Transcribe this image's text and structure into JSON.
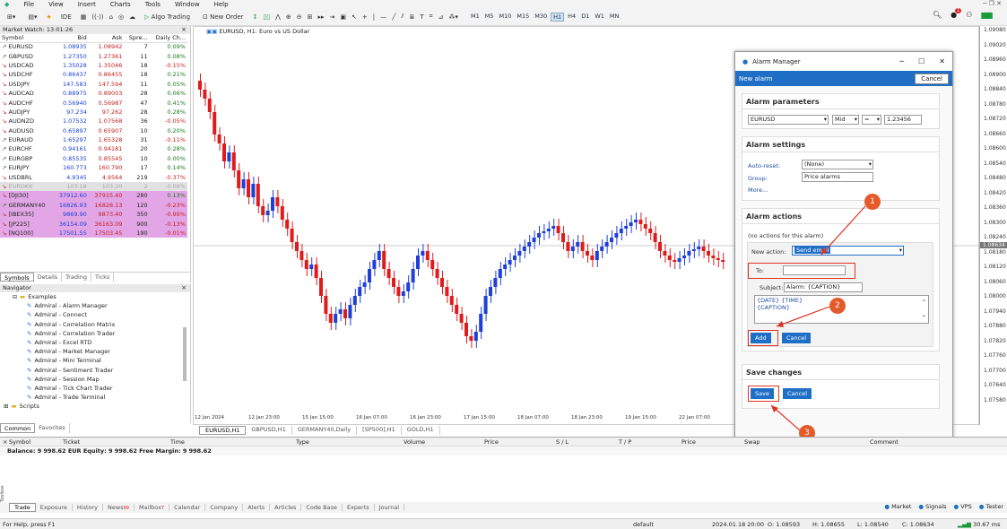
{
  "menu": [
    "File",
    "View",
    "Insert",
    "Charts",
    "Tools",
    "Window",
    "Help"
  ],
  "toolbar": {
    "ide_label": "IDE",
    "algo_label": "Algo Trading",
    "new_order_label": "New Order",
    "timeframes": [
      "M1",
      "M5",
      "M10",
      "M15",
      "M30",
      "H1",
      "H4",
      "D1",
      "W1",
      "MN"
    ],
    "active_timeframe": "H1",
    "notif_count": "1"
  },
  "market_watch": {
    "title": "Market Watch: 13:01:26",
    "headers": [
      "Symbol",
      "Bid",
      "Ask",
      "Spre...",
      "Daily Ch..."
    ],
    "rows": [
      {
        "dir": "up",
        "sym": "EURUSD",
        "bid": "1.08935",
        "ask": "1.08942",
        "spread": "7",
        "chg": "0.09%",
        "cls": ""
      },
      {
        "dir": "up",
        "sym": "GBPUSD",
        "bid": "1.27350",
        "ask": "1.27361",
        "spread": "11",
        "chg": "0.08%",
        "cls": ""
      },
      {
        "dir": "dn",
        "sym": "USDCAD",
        "bid": "1.35028",
        "ask": "1.35046",
        "spread": "18",
        "chg": "-0.15%",
        "cls": ""
      },
      {
        "dir": "dn",
        "sym": "USDCHF",
        "bid": "0.86437",
        "ask": "0.86455",
        "spread": "18",
        "chg": "0.21%",
        "cls": ""
      },
      {
        "dir": "dn",
        "sym": "USDJPY",
        "bid": "147.583",
        "ask": "147.594",
        "spread": "11",
        "chg": "0.05%",
        "cls": ""
      },
      {
        "dir": "dn",
        "sym": "AUDCAD",
        "bid": "0.88975",
        "ask": "0.89003",
        "spread": "28",
        "chg": "0.06%",
        "cls": ""
      },
      {
        "dir": "dn",
        "sym": "AUDCHF",
        "bid": "0.56940",
        "ask": "0.56987",
        "spread": "47",
        "chg": "0.41%",
        "cls": ""
      },
      {
        "dir": "dn",
        "sym": "AUDJPY",
        "bid": "97.234",
        "ask": "97.262",
        "spread": "28",
        "chg": "0.28%",
        "cls": ""
      },
      {
        "dir": "dn",
        "sym": "AUDNZD",
        "bid": "1.07532",
        "ask": "1.07568",
        "spread": "36",
        "chg": "-0.05%",
        "cls": ""
      },
      {
        "dir": "dn",
        "sym": "AUDUSD",
        "bid": "0.65897",
        "ask": "0.65907",
        "spread": "10",
        "chg": "0.20%",
        "cls": ""
      },
      {
        "dir": "up",
        "sym": "EURAUD",
        "bid": "1.65297",
        "ask": "1.65328",
        "spread": "31",
        "chg": "-0.11%",
        "cls": ""
      },
      {
        "dir": "up",
        "sym": "EURCHF",
        "bid": "0.94161",
        "ask": "0.94181",
        "spread": "20",
        "chg": "0.28%",
        "cls": ""
      },
      {
        "dir": "up",
        "sym": "EURGBP",
        "bid": "0.85535",
        "ask": "0.85545",
        "spread": "10",
        "chg": "0.00%",
        "cls": ""
      },
      {
        "dir": "up",
        "sym": "EURJPY",
        "bid": "160.773",
        "ask": "160.790",
        "spread": "17",
        "chg": "0.14%",
        "cls": ""
      },
      {
        "dir": "dn",
        "sym": "USDBRL",
        "bid": "4.9345",
        "ask": "4.9564",
        "spread": "219",
        "chg": "-0.37%",
        "cls": ""
      },
      {
        "dir": "dn",
        "sym": "EURDKK",
        "bid": "103.18",
        "ask": "103.20",
        "spread": "2",
        "chg": "-0.08%",
        "cls": "gray"
      },
      {
        "dir": "dn",
        "sym": "[DJI30]",
        "bid": "37912.60",
        "ask": "37915.40",
        "spread": "280",
        "chg": "0.13%",
        "cls": "pink"
      },
      {
        "dir": "up",
        "sym": "GERMANY40",
        "bid": "16826.93",
        "ask": "16828.13",
        "spread": "120",
        "chg": "-0.23%",
        "cls": "pink"
      },
      {
        "dir": "dn",
        "sym": "[IBEX35]",
        "bid": "9869.90",
        "ask": "9873.40",
        "spread": "350",
        "chg": "-0.99%",
        "cls": "pink"
      },
      {
        "dir": "dn",
        "sym": "[JP225]",
        "bid": "36154.09",
        "ask": "36163.09",
        "spread": "900",
        "chg": "-0.13%",
        "cls": "pink"
      },
      {
        "dir": "dn",
        "sym": "[NQ100]",
        "bid": "17501.55",
        "ask": "17503.45",
        "spread": "190",
        "chg": "-0.01%",
        "cls": "pink"
      }
    ],
    "tabs": [
      "Symbols",
      "Details",
      "Trading",
      "Ticks"
    ]
  },
  "navigator": {
    "title": "Navigator",
    "folder": "Examples",
    "items": [
      "Admiral - Alarm Manager",
      "Admiral - Connect",
      "Admiral - Correlation Matrix",
      "Admiral - Correlation Trader",
      "Admiral - Excel RTD",
      "Admiral - Market Manager",
      "Admiral - Mini Terminal",
      "Admiral - Sentiment Trader",
      "Admiral - Session Map",
      "Admiral - Tick Chart Trader",
      "Admiral - Trade Terminal"
    ],
    "scripts": "Scripts",
    "tabs": [
      "Common",
      "Favorites"
    ]
  },
  "chart": {
    "title": "EURUSD, H1:  Euro vs US Dollar",
    "price_labels": [
      "1.09080",
      "1.09020",
      "1.08960",
      "1.08900",
      "1.08840",
      "1.08780",
      "1.08720",
      "1.08660",
      "1.08600",
      "1.08540",
      "1.08480",
      "1.08420",
      "1.08360",
      "1.08300",
      "1.08240",
      "1.08180",
      "1.08120",
      "1.08060",
      "1.08000",
      "1.07940",
      "1.07880",
      "1.07820",
      "1.07760",
      "1.07700",
      "1.07640",
      "1.07580"
    ],
    "current_price": "1.08634",
    "time_labels": [
      "12 Jan 2024",
      "12 Jan 23:00",
      "15 Jan 15:00",
      "16 Jan 07:00",
      "16 Jan 23:00",
      "17 Jan 15:00",
      "18 Jan 07:00",
      "18 Jan 23:00",
      "19 Jan 15:00",
      "22 Jan 07:00"
    ],
    "tabs": [
      "EURUSD,H1",
      "GBPUSD,H1",
      "GERMANY40,Daily",
      "[SP500],H1",
      "GOLD,H1"
    ]
  },
  "alarm_manager": {
    "window_title": "Alarm Manager",
    "bar_label": "New alarm",
    "cancel_top": "Cancel",
    "params_header": "Alarm parameters",
    "symbol": "EURUSD",
    "price_type": "Mid",
    "operator": "=",
    "value": "1.23456",
    "settings_header": "Alarm settings",
    "autoreset_label": "Auto-reset:",
    "autoreset_value": "(None)",
    "group_label": "Group:",
    "group_value": "Price alarms",
    "more_label": "More...",
    "actions_header": "Alarm actions",
    "no_actions": "(no actions for this alarm)",
    "new_action_label": "New action:",
    "new_action_value": "Send email",
    "to_label": "To:",
    "to_value": "",
    "subject_label": "Subject:",
    "subject_value": "Alarm: {CAPTION}",
    "body_line1": "{DATE} {TIME}",
    "body_line2": "{CAPTION}",
    "add_label": "Add",
    "cancel_mid": "Cancel",
    "save_header": "Save changes",
    "save_label": "Save",
    "cancel_bottom": "Cancel",
    "markers": [
      "1",
      "2",
      "3"
    ]
  },
  "terminal": {
    "columns": [
      "Symbol",
      "Ticket",
      "Time",
      "Type",
      "Volume",
      "Price",
      "S / L",
      "T / P",
      "Price",
      "Swap",
      "Comment"
    ],
    "balance": "Balance: 9 998.62 EUR  Equity: 9 998.62  Free Margin: 9 998.62",
    "tabs": [
      "Trade",
      "Exposure",
      "History",
      "News",
      "Mailbox",
      "Calendar",
      "Company",
      "Alerts",
      "Articles",
      "Code Base",
      "Experts",
      "Journal"
    ],
    "news_badge": "99",
    "mailbox_badge": "7",
    "right_items": [
      "Market",
      "Signals",
      "VPS",
      "Tester"
    ],
    "toolbox": "Toolbox"
  },
  "status": {
    "help": "For Help, press F1",
    "profile": "default",
    "datetime": "2024.01.18 20:00",
    "open": "O: 1.08593",
    "high": "H: 1.08655",
    "low": "L: 1.08540",
    "close": "C: 1.08634",
    "ping": "30.67 ms"
  }
}
